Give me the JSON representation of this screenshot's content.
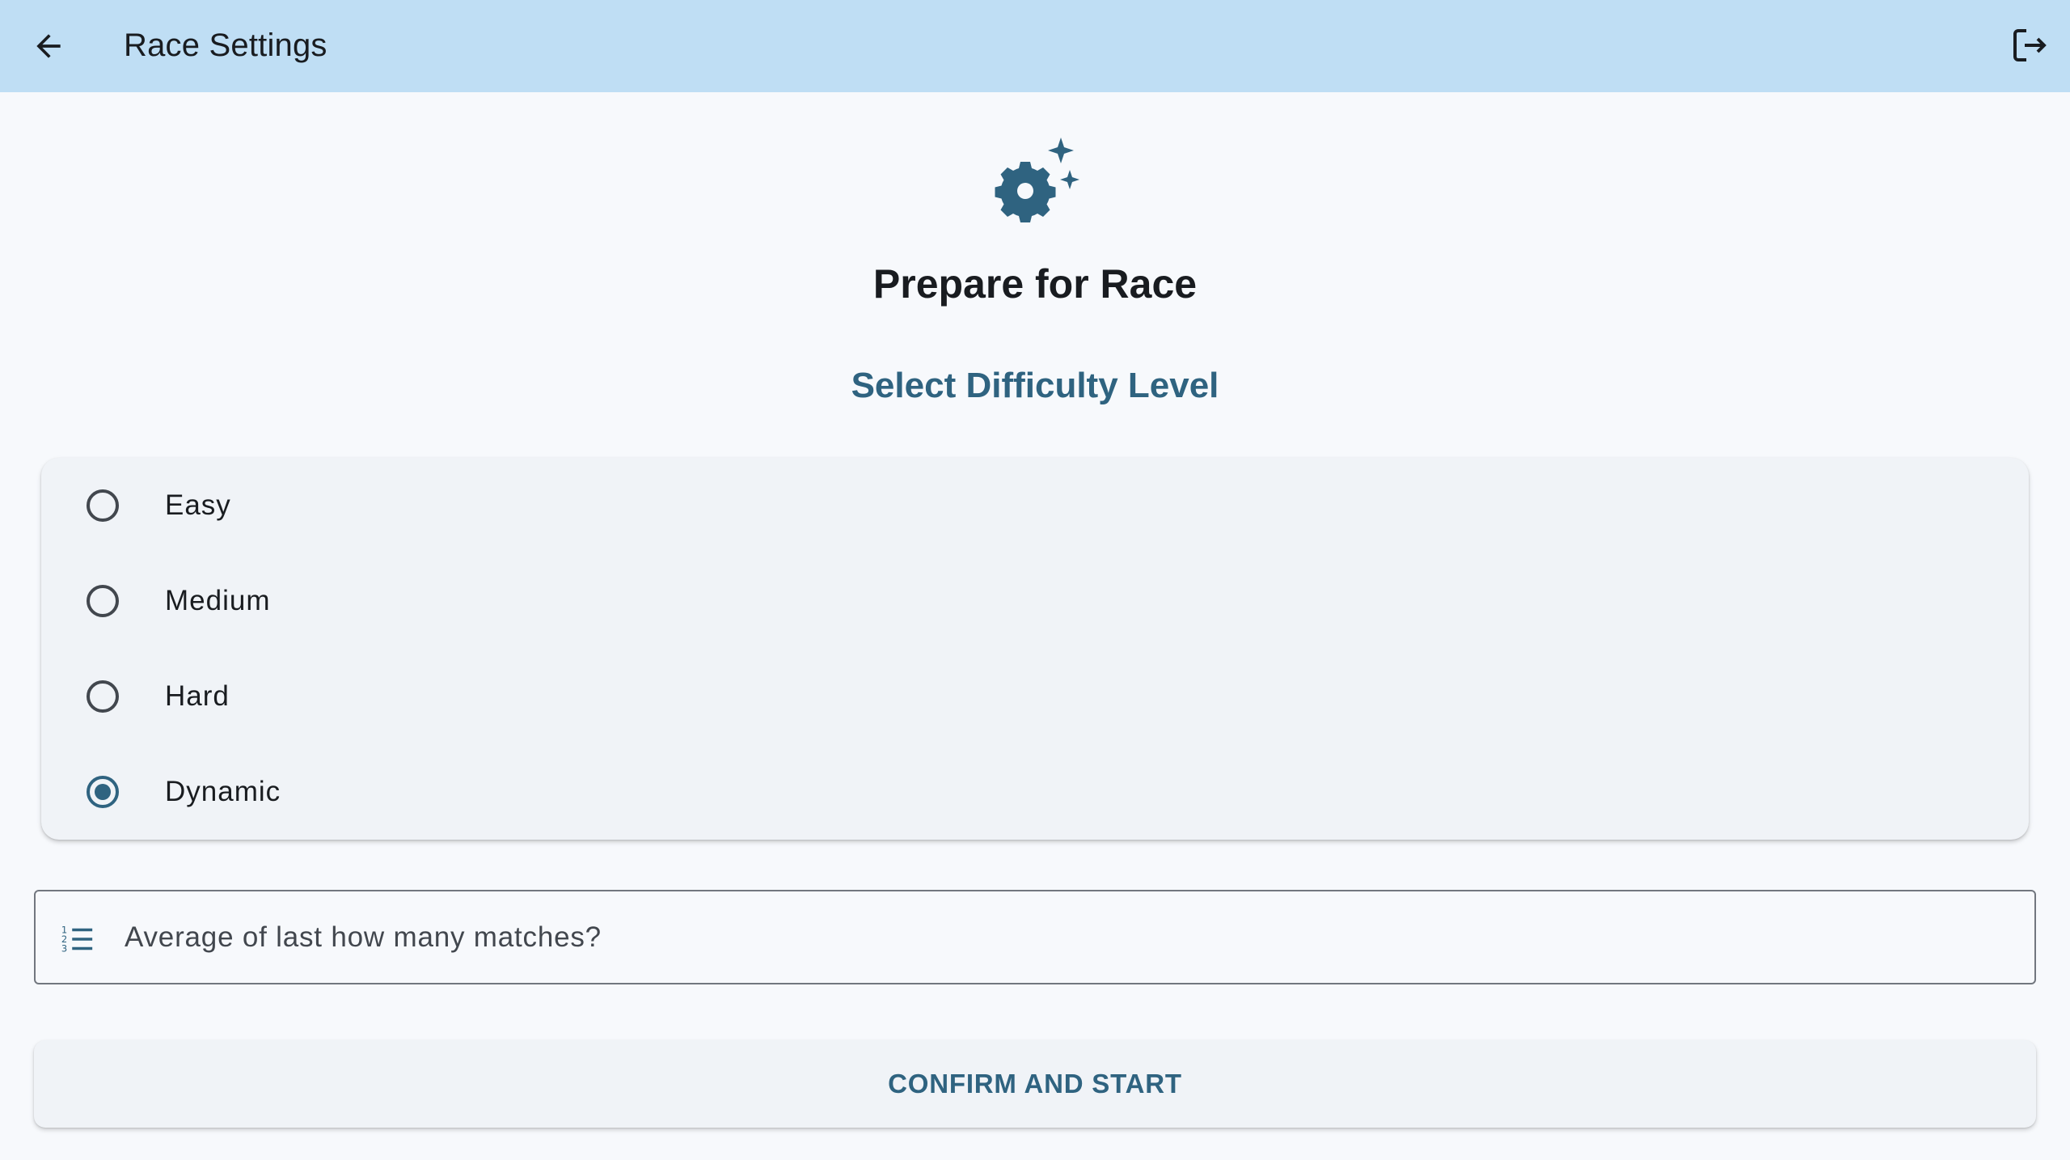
{
  "appbar": {
    "title": "Race Settings",
    "back_icon": "arrow-left-icon",
    "logout_icon": "logout-icon",
    "background": "#bfdef4"
  },
  "hero": {
    "icon": "settings-sparkle-icon",
    "heading": "Prepare for Race",
    "subheading": "Select Difficulty Level"
  },
  "difficulty": {
    "options": [
      {
        "label": "Easy",
        "selected": false
      },
      {
        "label": "Medium",
        "selected": false
      },
      {
        "label": "Hard",
        "selected": false
      },
      {
        "label": "Dynamic",
        "selected": true
      }
    ],
    "selected": "Dynamic"
  },
  "matches_field": {
    "icon": "numbered-list-icon",
    "placeholder": "Average of last how many matches?",
    "value": ""
  },
  "confirm_button": {
    "label": "CONFIRM AND START"
  },
  "colors": {
    "primary": "#2f6380",
    "surface": "#f7f9fc",
    "card": "#f0f3f7"
  }
}
